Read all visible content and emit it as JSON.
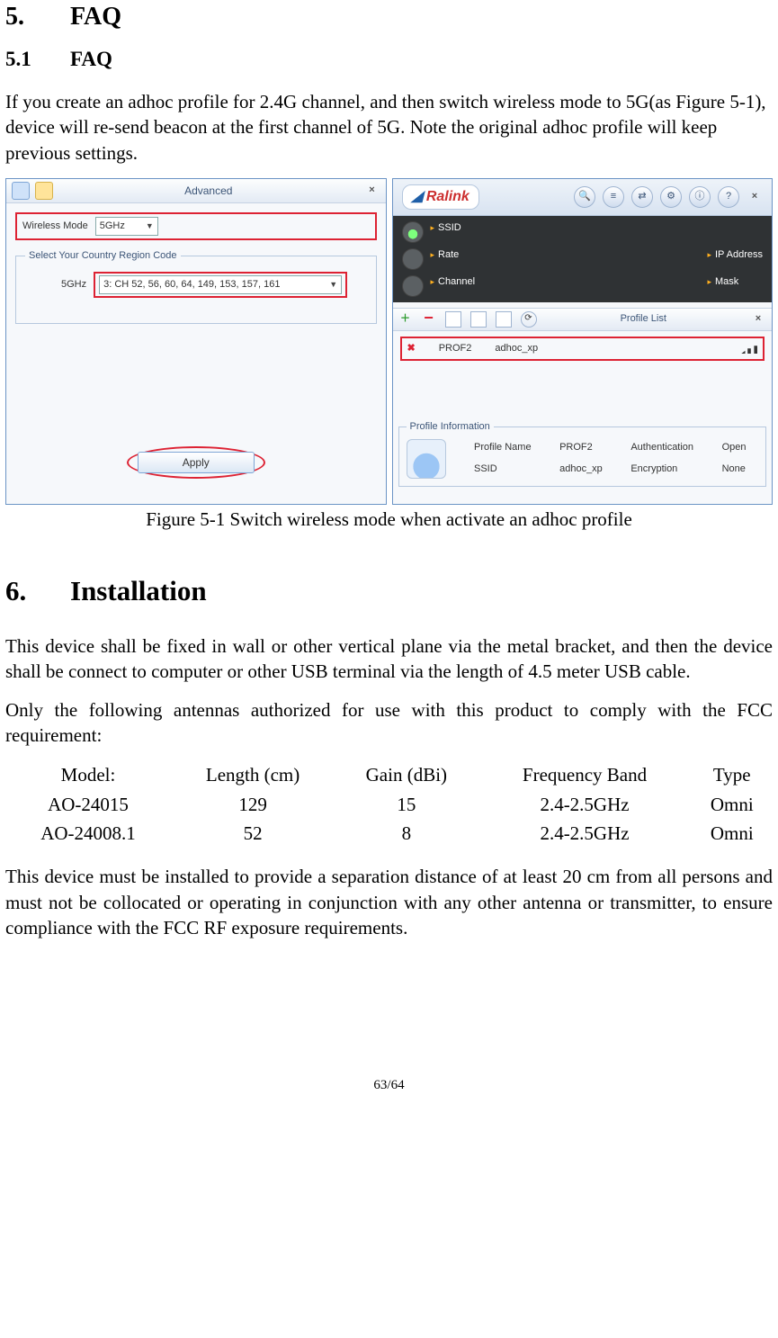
{
  "section5": {
    "number": "5.",
    "title": "FAQ",
    "sub_number": "5.1",
    "sub_title": "FAQ",
    "intro": "If you create an adhoc profile for 2.4G channel, and then switch wireless mode to 5G(as Figure 5-1), device will re-send beacon at the first channel of 5G. Note the original adhoc profile will keep previous settings."
  },
  "figure": {
    "caption": "Figure 5-1 Switch wireless mode when activate an adhoc profile",
    "left": {
      "title": "Advanced",
      "wm_label": "Wireless Mode",
      "wm_value": "5GHz",
      "region_legend": "Select Your Country Region Code",
      "region_band": "5GHz",
      "region_value": "3:  CH  52,  56,  60,  64, 149, 153, 157, 161",
      "apply": "Apply"
    },
    "right": {
      "brand": "Ralink",
      "dark": {
        "ssid": "SSID",
        "rate": "Rate",
        "channel": "Channel",
        "ip": "IP Address",
        "mask": "Mask"
      },
      "pl_title": "Profile List",
      "profile": {
        "name": "PROF2",
        "ssid": "adhoc_xp"
      },
      "pi_legend": "Profile Information",
      "pi": {
        "pn_l": "Profile Name",
        "pn_v": "PROF2",
        "ss_l": "SSID",
        "ss_v": "adhoc_xp",
        "au_l": "Authentication",
        "au_v": "Open",
        "en_l": "Encryption",
        "en_v": "None"
      }
    }
  },
  "section6": {
    "number": "6.",
    "title": "Installation",
    "p1": "This device shall be fixed in wall or other vertical plane via the metal bracket, and then the device shall be connect to computer or other USB terminal via the length of 4.5 meter USB cable.",
    "p2": "Only the following antennas authorized for use with this product to comply with the FCC requirement:",
    "p3": "This device must be installed to provide a separation distance of at least 20 cm from all persons and must not be collocated or operating in conjunction with any other antenna or transmitter, to ensure compliance with the FCC RF exposure requirements."
  },
  "chart_data": {
    "type": "table",
    "columns": [
      "Model:",
      "Length (cm)",
      "Gain (dBi)",
      "Frequency Band",
      "Type"
    ],
    "rows": [
      [
        "AO-24015",
        "129",
        "15",
        "2.4-2.5GHz",
        "Omni"
      ],
      [
        "AO-24008.1",
        "52",
        "8",
        "2.4-2.5GHz",
        "Omni"
      ]
    ]
  },
  "page": "63/64"
}
